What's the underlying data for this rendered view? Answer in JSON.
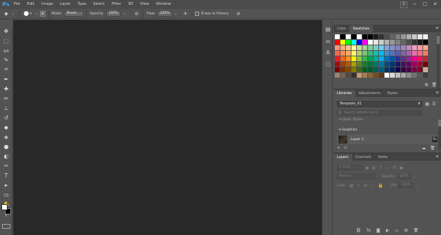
{
  "app": {
    "logo": "Ps"
  },
  "menubar": {
    "items": [
      "File",
      "Edit",
      "Image",
      "Layer",
      "Type",
      "Select",
      "Filter",
      "3D",
      "View",
      "Window"
    ]
  },
  "window_controls": {
    "search_icon": "search-icon",
    "minimize": "−",
    "maximize": "□",
    "close": "✕"
  },
  "options_bar": {
    "brush_size": "8",
    "mode_label": "Mode:",
    "mode_value": "Brush",
    "opacity_label": "Opacity:",
    "opacity_value": "100%",
    "flow_label": "Flow:",
    "flow_value": "100%",
    "erase_history_label": "Erase to History"
  },
  "tools": [
    "move-tool-icon",
    "marquee-tool-icon",
    "lasso-tool-icon",
    "quick-select-tool-icon",
    "crop-tool-icon",
    "eyedropper-tool-icon",
    "healing-brush-tool-icon",
    "brush-tool-icon",
    "clone-stamp-tool-icon",
    "history-brush-tool-icon",
    "eraser-tool-icon",
    "paint-bucket-tool-icon",
    "blur-tool-icon",
    "dodge-tool-icon",
    "pen-tool-icon",
    "type-tool-icon",
    "path-selection-tool-icon",
    "rectangle-tool-icon",
    "hand-tool-icon",
    "zoom-tool-icon"
  ],
  "tool_glyphs": [
    "✥",
    "⬚",
    "ᔕ",
    "✎",
    "⌗",
    "✒",
    "✚",
    "✏",
    "⊥",
    "↺",
    "◆",
    "◈",
    "●",
    "◐",
    "✑",
    "T",
    "▸",
    "▭",
    "✋",
    "⚲"
  ],
  "colors": {
    "foreground": "#ffffff",
    "background": "#000000",
    "canvas_bg": "#282828"
  },
  "swatches_panel": {
    "tabs": [
      "Color",
      "Swatches"
    ],
    "active_tab": "Swatches",
    "rows": [
      [
        "#ffffff",
        "#000000",
        "#ffffff",
        "#000000",
        "#ffffff",
        "#000000",
        "#000000",
        "#1a1a1a",
        "#333333",
        "#4d4d4d",
        "#666666",
        "#808080",
        "#999999",
        "#b3b3b3",
        "#cccccc",
        "#e6e6e6",
        "#f2f2f2"
      ],
      [
        "#ff0000",
        "#ffff00",
        "#00ff00",
        "#00ffff",
        "#0000ff",
        "#ff00ff",
        "#ffffff",
        "#e6e6e6",
        "#cccccc",
        "#b3b3b3",
        "#999999",
        "#808080",
        "#666666",
        "#4d4d4d",
        "#333333",
        "#1a1a1a",
        "#000000"
      ],
      [
        "#f7977a",
        "#fbad82",
        "#fdc68c",
        "#fff799",
        "#c4df9b",
        "#a3d39c",
        "#82ca9d",
        "#7bcdc8",
        "#6ecff6",
        "#7ea7d8",
        "#8493ca",
        "#8882be",
        "#a187be",
        "#bc8dbf",
        "#f49ac2",
        "#f6989d",
        "#f9a58a"
      ],
      [
        "#f26c4f",
        "#f68e56",
        "#fbaf5c",
        "#fff467",
        "#acd372",
        "#7cc576",
        "#3bb878",
        "#1abbb4",
        "#00bff3",
        "#438ccb",
        "#5574b9",
        "#605ca8",
        "#855fa8",
        "#a763a9",
        "#ef6ea8",
        "#f16d7e",
        "#f57b5e"
      ],
      [
        "#ed1c24",
        "#f26522",
        "#f7941d",
        "#fff200",
        "#8dc63f",
        "#39b54a",
        "#00a651",
        "#00a99d",
        "#00aeef",
        "#0072bc",
        "#0054a5",
        "#2e3192",
        "#662d91",
        "#92278f",
        "#ec008c",
        "#ed145b",
        "#c1272d"
      ],
      [
        "#9e0b0f",
        "#a0410d",
        "#a3620a",
        "#aba000",
        "#598527",
        "#1a7b30",
        "#007236",
        "#00746b",
        "#0076a3",
        "#004b80",
        "#003471",
        "#1b1464",
        "#440e62",
        "#630460",
        "#9e005d",
        "#9e0039",
        "#790000"
      ],
      [
        "#790000",
        "#7b2e00",
        "#7d4900",
        "#827b00",
        "#406618",
        "#005e20",
        "#005826",
        "#005952",
        "#005b7f",
        "#003663",
        "#002157",
        "#0d004c",
        "#32004b",
        "#4b0049",
        "#7b0046",
        "#7a0026",
        "#c7b299"
      ],
      [
        "#998675",
        "#736357",
        "#534741",
        "#37302d",
        "#c69c6e",
        "#a67c52",
        "#8c6239",
        "#754c24",
        "#603913",
        "#ffffff",
        "#d9d9d9",
        "#bfbfbf",
        "#a6a6a6",
        "#8c8c8c",
        "#737373",
        "#595959",
        "#404040"
      ]
    ]
  },
  "libraries_panel": {
    "tabs": [
      "Libraries",
      "Adjustments",
      "Styles"
    ],
    "active_tab": "Libraries",
    "library_name": "Template_01",
    "search_placeholder": "Search Adobe Stock",
    "layer_styles_label": "Layer Styles",
    "graphics_label": "Graphics",
    "item_name": "Layer 1"
  },
  "layers_panel": {
    "tabs": [
      "Layers",
      "Channels",
      "Paths"
    ],
    "active_tab": "Layers",
    "kind_label": "Kind",
    "blend_mode": "Normal",
    "opacity_label": "Opacity:",
    "opacity_value": "100%",
    "lock_label": "Lock:",
    "fill_label": "Fill:",
    "fill_value": "100%"
  }
}
